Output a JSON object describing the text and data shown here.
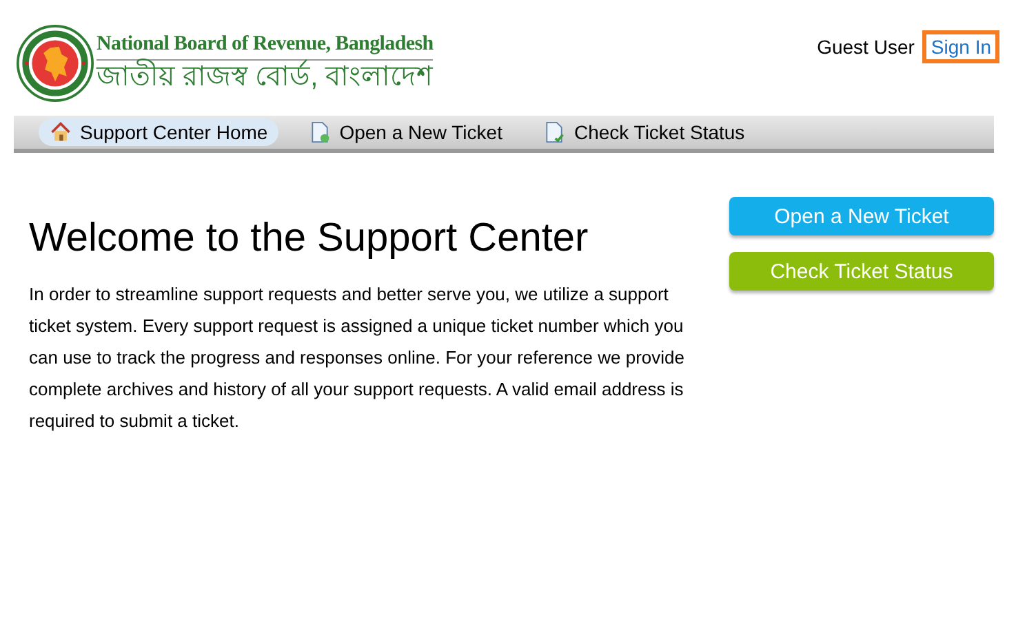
{
  "header": {
    "logo_title": "National Board of Revenue, Bangladesh",
    "logo_subtitle": "জাতীয় রাজস্ব বোর্ড, বাংলাদেশ",
    "user": "Guest User",
    "sign_in": {
      "label": "Sign In",
      "highlighted": true
    }
  },
  "nav": [
    {
      "label": "Support Center Home",
      "kind": "home",
      "selected": true
    },
    {
      "label": "Open a New Ticket",
      "kind": "new",
      "selected": false
    },
    {
      "label": "Check Ticket Status",
      "kind": "status",
      "selected": false
    }
  ],
  "content": {
    "heading": "Welcome to the Support Center",
    "text": "In order to streamline support requests and better serve you, we utilize a support ticket system. Every support request is assigned a unique ticket number which you can use to track the progress and responses online. For your reference we provide complete archives and history of all your support requests. A valid email address is required to submit a ticket."
  },
  "actions": [
    {
      "label": "Open a New Ticket",
      "kind": "blue"
    },
    {
      "label": "Check Ticket Status",
      "kind": "green"
    }
  ]
}
